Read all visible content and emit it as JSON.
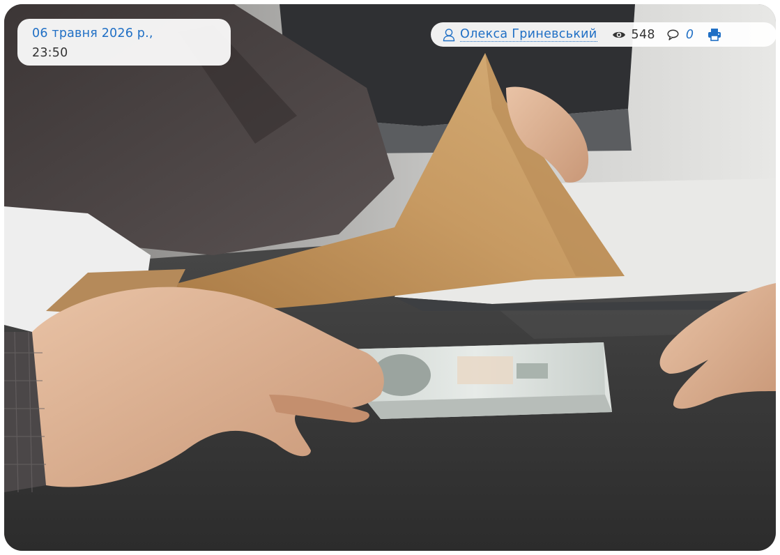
{
  "post": {
    "date": "06 травня 2026 р.,",
    "time": "23:50",
    "author": "Олекса Гриневський",
    "views": "548",
    "comments": "0"
  },
  "icons": {
    "author": "user-icon",
    "views": "eye-icon",
    "comments": "comment-bubble-icon",
    "print": "print-icon"
  },
  "colors": {
    "link": "#1f6fc5",
    "text": "#333333",
    "pill_background": "#ffffff"
  },
  "image": {
    "semantic": "article-photo"
  }
}
